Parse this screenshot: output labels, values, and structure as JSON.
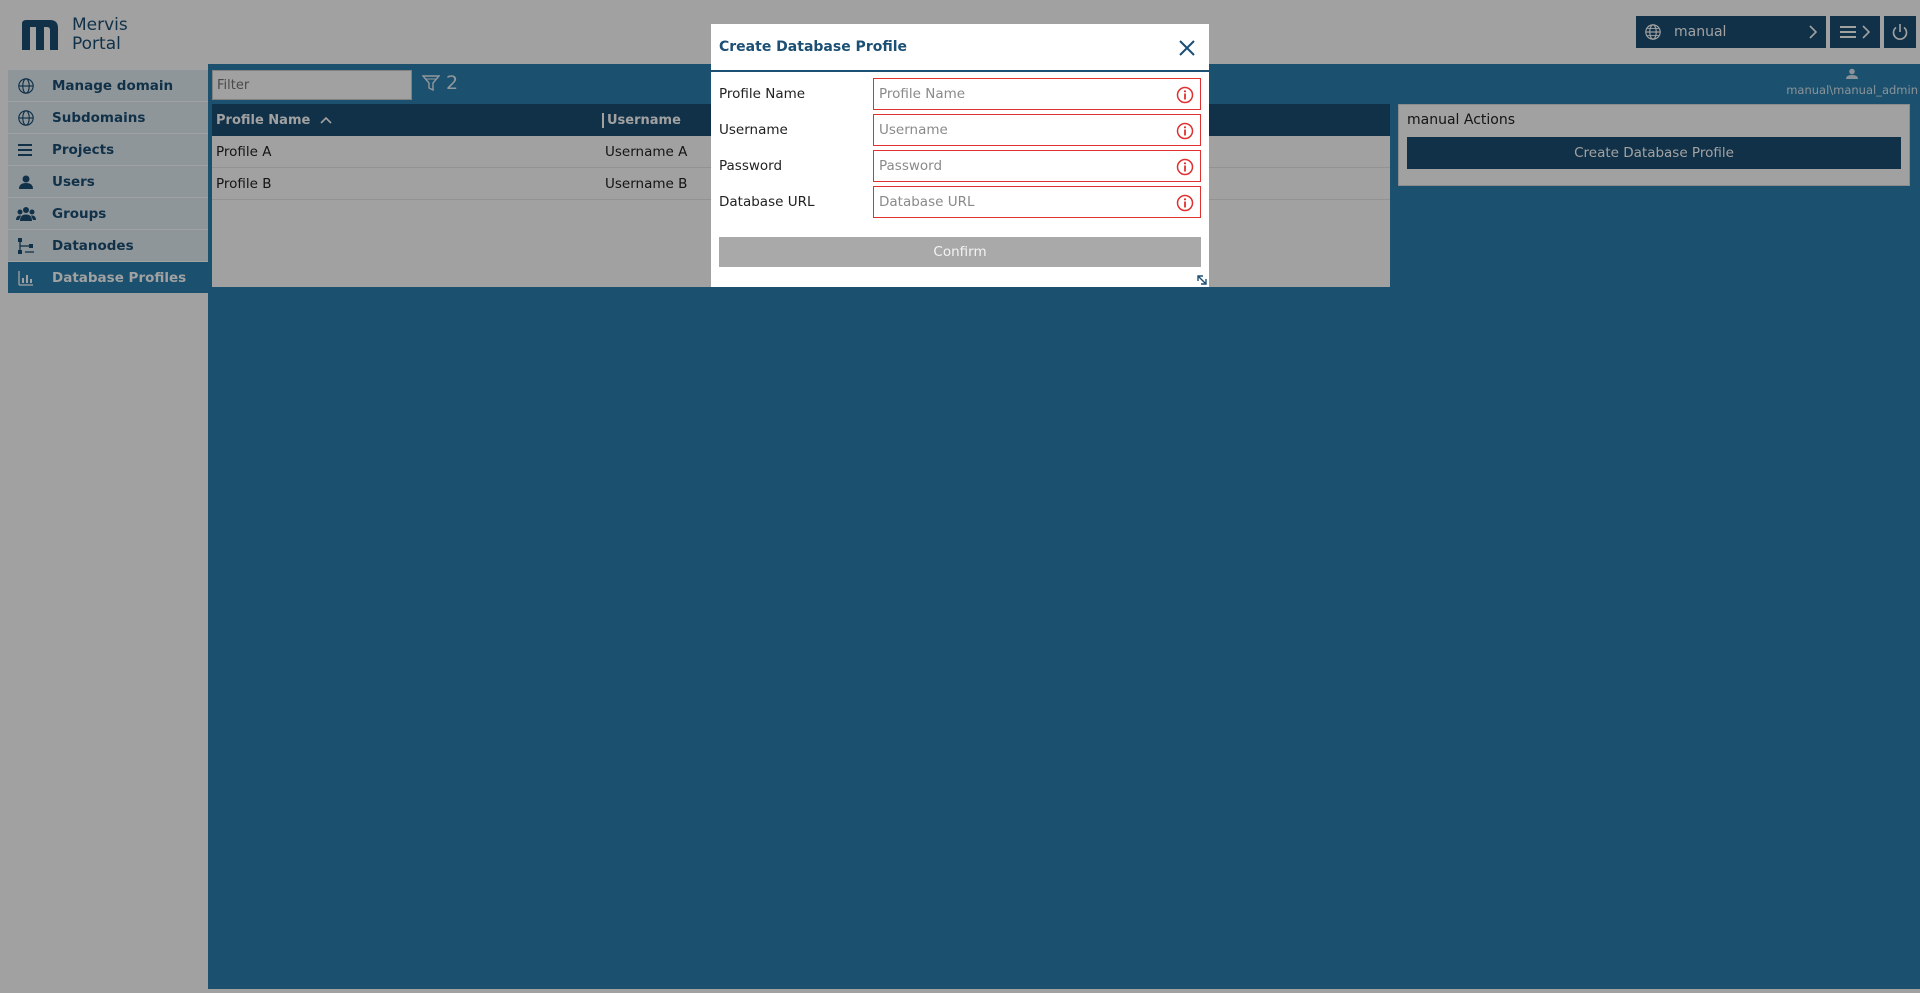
{
  "app": {
    "name_line1": "Mervis",
    "name_line2": "Portal"
  },
  "topbar": {
    "domain_value": "manual"
  },
  "sidebar": {
    "items": [
      {
        "label": "Manage domain",
        "icon": "globe-icon"
      },
      {
        "label": "Subdomains",
        "icon": "globe-icon"
      },
      {
        "label": "Projects",
        "icon": "list-icon"
      },
      {
        "label": "Users",
        "icon": "user-icon"
      },
      {
        "label": "Groups",
        "icon": "group-icon"
      },
      {
        "label": "Datanodes",
        "icon": "datanode-icon"
      },
      {
        "label": "Database Profiles",
        "icon": "database-icon"
      }
    ],
    "active_index": 6
  },
  "toolbar": {
    "filter_placeholder": "Filter",
    "filter_count": "2"
  },
  "user": {
    "name": "manual\\manual_admin"
  },
  "grid": {
    "columns": [
      "Profile Name",
      "Username"
    ],
    "rows": [
      [
        "Profile A",
        "Username A"
      ],
      [
        "Profile B",
        "Username B"
      ]
    ]
  },
  "actions": {
    "title": "manual Actions",
    "create_label": "Create Database Profile"
  },
  "modal": {
    "title": "Create Database Profile",
    "fields": [
      {
        "label": "Profile Name",
        "placeholder": "Profile Name"
      },
      {
        "label": "Username",
        "placeholder": "Username"
      },
      {
        "label": "Password",
        "placeholder": "Password"
      },
      {
        "label": "Database URL",
        "placeholder": "Database URL"
      }
    ],
    "confirm_label": "Confirm"
  },
  "colors": {
    "brand": "#1b4f74",
    "accent": "#2b7fae",
    "error": "#e03030",
    "disabled": "#a9a9a9"
  }
}
